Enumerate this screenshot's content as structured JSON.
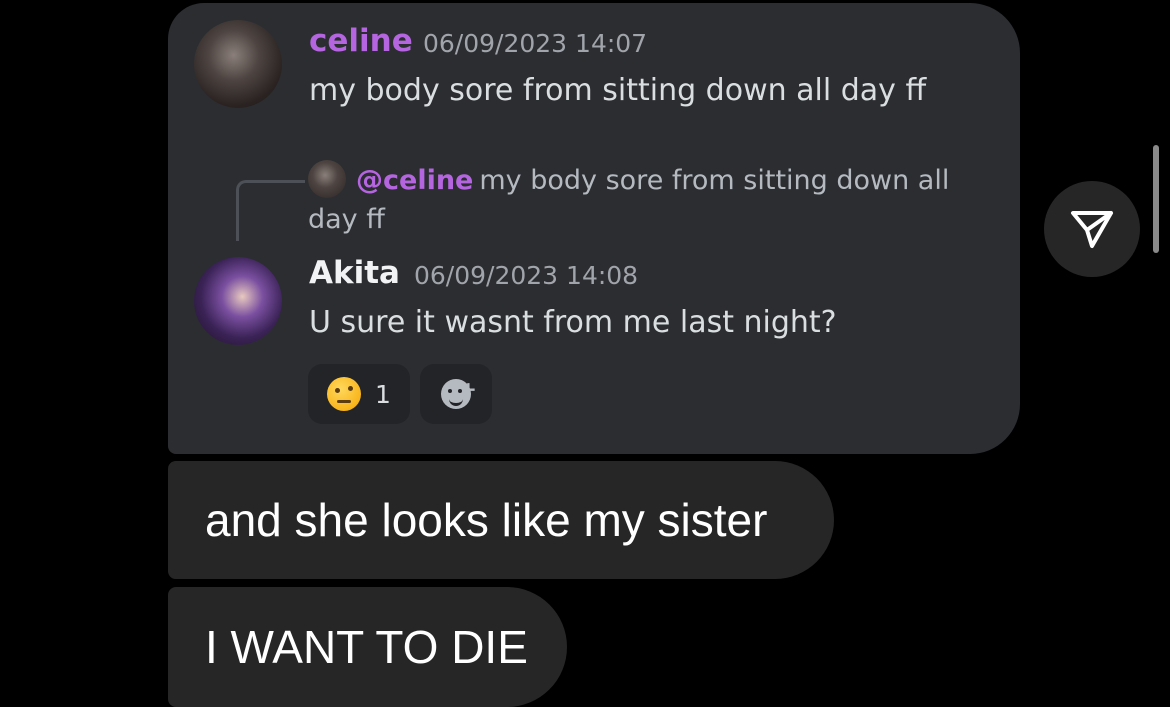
{
  "shared_message": {
    "original": {
      "username": "celine",
      "timestamp": "06/09/2023 14:07",
      "text": "my body sore from sitting down all day ff",
      "avatar_icon": "avatar-celine"
    },
    "reply_preview": {
      "mention": "@celine",
      "text_line1": "my body sore from sitting down all",
      "text_line2": "day ff"
    },
    "reply": {
      "username": "Akita",
      "timestamp": "06/09/2023 14:08",
      "text": "U sure it wasnt from me last night?",
      "avatar_icon": "avatar-akita"
    },
    "reactions": [
      {
        "emoji": "raised-eyebrow-emoji",
        "count": "1"
      }
    ],
    "add_reaction_icon": "add-reaction-icon"
  },
  "bubbles": [
    {
      "text": "and she looks like my sister"
    },
    {
      "text": "I WANT TO DIE"
    }
  ],
  "share_icon": "send-arrow-icon",
  "colors": {
    "background": "#000000",
    "card": "#2b2d31",
    "bubble": "#262626",
    "username_celine": "#b665e0",
    "timestamp": "#a1a4aa"
  }
}
